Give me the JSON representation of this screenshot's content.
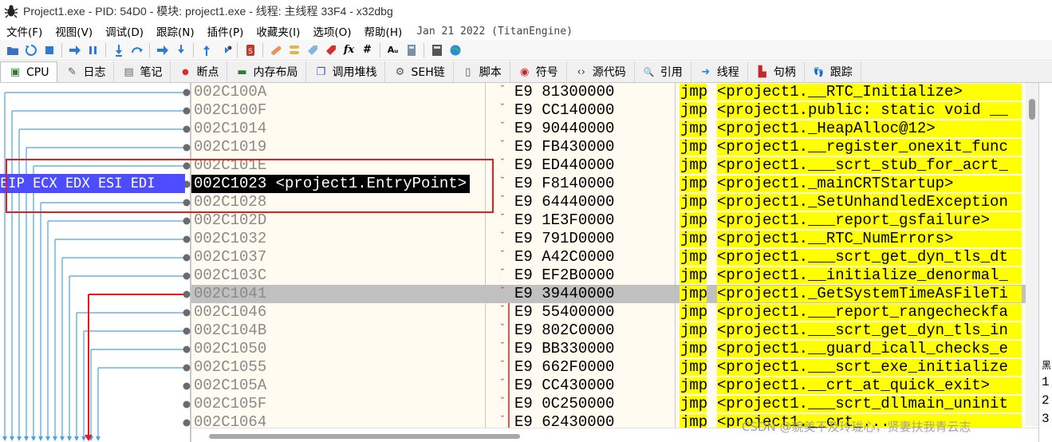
{
  "window": {
    "title": "Project1.exe - PID: 54D0 - 模块: project1.exe - 线程: 主线程 33F4 - x32dbg"
  },
  "menu": {
    "items": [
      "文件(F)",
      "视图(V)",
      "调试(D)",
      "跟踪(N)",
      "插件(P)",
      "收藏夹(I)",
      "选项(O)",
      "帮助(H)"
    ],
    "date": "Jan 21 2022 (TitanEngine)"
  },
  "toolbar": {
    "icons": [
      "open-icon",
      "restart-icon",
      "stop-icon",
      "run-icon",
      "pause-icon",
      "step-into-icon",
      "step-over-icon",
      "trace-into-icon",
      "trace-over-icon",
      "execute-till-return-icon",
      "run-to-user-code-icon",
      "scylla-icon",
      "patches-icon",
      "comments-icon",
      "labels-icon",
      "bookmarks-icon",
      "functions-icon",
      "variables-icon",
      "hash-icon",
      "font-icon",
      "trace-icon",
      "calculator-icon",
      "globe-icon"
    ],
    "fx_label": "fx",
    "hash_label": "#",
    "az_label": "Aᵤ"
  },
  "tabs": [
    {
      "label": "CPU",
      "icon": "cpu-icon",
      "glyph": "▣",
      "active": true
    },
    {
      "label": "日志",
      "icon": "log-icon",
      "glyph": "✎"
    },
    {
      "label": "笔记",
      "icon": "notes-icon",
      "glyph": "▤"
    },
    {
      "label": "断点",
      "icon": "breakpoint-icon",
      "glyph": "●"
    },
    {
      "label": "内存布局",
      "icon": "memory-map-icon",
      "glyph": "▬"
    },
    {
      "label": "调用堆栈",
      "icon": "call-stack-icon",
      "glyph": "❐"
    },
    {
      "label": "SEH链",
      "icon": "seh-icon",
      "glyph": "⚙"
    },
    {
      "label": "脚本",
      "icon": "script-icon",
      "glyph": "▯"
    },
    {
      "label": "符号",
      "icon": "symbols-icon",
      "glyph": "◉"
    },
    {
      "label": "源代码",
      "icon": "source-icon",
      "glyph": "‹›"
    },
    {
      "label": "引用",
      "icon": "references-icon",
      "glyph": "🔍"
    },
    {
      "label": "线程",
      "icon": "threads-icon",
      "glyph": "➜"
    },
    {
      "label": "句柄",
      "icon": "handles-icon",
      "glyph": "▙"
    },
    {
      "label": "跟踪",
      "icon": "trace-icon",
      "glyph": "👣"
    }
  ],
  "registers_label": "EIP ECX EDX ESI EDI",
  "disasm": {
    "rows": [
      {
        "addr": "002C100A",
        "bytes": "E9 81300000",
        "mnemonic": "jmp",
        "operand": "<project1.__RTC_Initialize>"
      },
      {
        "addr": "002C100F",
        "bytes": "E9 CC140000",
        "mnemonic": "jmp",
        "operand": "<project1.public: static void __"
      },
      {
        "addr": "002C1014",
        "bytes": "E9 90440000",
        "mnemonic": "jmp",
        "operand": "<project1._HeapAlloc@12>"
      },
      {
        "addr": "002C1019",
        "bytes": "E9 FB430000",
        "mnemonic": "jmp",
        "operand": "<project1.__register_onexit_func"
      },
      {
        "addr": "002C101E",
        "bytes": "E9 ED440000",
        "mnemonic": "jmp",
        "operand": "<project1.___scrt_stub_for_acrt_"
      },
      {
        "addr": "002C1023",
        "bytes": "E9 F8140000",
        "mnemonic": "jmp",
        "operand": "<project1._mainCRTStartup>",
        "eip": true,
        "eip_label": "<project1.EntryPoint>"
      },
      {
        "addr": "002C1028",
        "bytes": "E9 64440000",
        "mnemonic": "jmp",
        "operand": "<project1._SetUnhandledException"
      },
      {
        "addr": "002C102D",
        "bytes": "E9 1E3F0000",
        "mnemonic": "jmp",
        "operand": "<project1.___report_gsfailure>"
      },
      {
        "addr": "002C1032",
        "bytes": "E9 791D0000",
        "mnemonic": "jmp",
        "operand": "<project1.__RTC_NumErrors>"
      },
      {
        "addr": "002C1037",
        "bytes": "E9 A42C0000",
        "mnemonic": "jmp",
        "operand": "<project1.___scrt_get_dyn_tls_dt"
      },
      {
        "addr": "002C103C",
        "bytes": "E9 EF2B0000",
        "mnemonic": "jmp",
        "operand": "<project1.__initialize_denormal_"
      },
      {
        "addr": "002C1041",
        "bytes": "E9 39440000",
        "mnemonic": "jmp",
        "operand": "<project1._GetSystemTimeAsFileTi",
        "selected": true
      },
      {
        "addr": "002C1046",
        "bytes": "E9 55400000",
        "mnemonic": "jmp",
        "operand": "<project1.___report_rangecheckfa"
      },
      {
        "addr": "002C104B",
        "bytes": "E9 802C0000",
        "mnemonic": "jmp",
        "operand": "<project1.___scrt_get_dyn_tls_in"
      },
      {
        "addr": "002C1050",
        "bytes": "E9 BB330000",
        "mnemonic": "jmp",
        "operand": "<project1.__guard_icall_checks_e"
      },
      {
        "addr": "002C1055",
        "bytes": "E9 662F0000",
        "mnemonic": "jmp",
        "operand": "<project1.___scrt_exe_initialize"
      },
      {
        "addr": "002C105A",
        "bytes": "E9 CC430000",
        "mnemonic": "jmp",
        "operand": "<project1.__crt_at_quick_exit>"
      },
      {
        "addr": "002C105F",
        "bytes": "E9 0C250000",
        "mnemonic": "jmp",
        "operand": "<project1.___scrt_dllmain_uninit"
      },
      {
        "addr": "002C1064",
        "bytes": "E9 62430000",
        "mnemonic": "jmp",
        "operand": "<project1.__crt_..."
      }
    ]
  },
  "right_pane": [
    "黑",
    "1",
    "2",
    "3"
  ],
  "watermark": "CSDN @貌美不及玲珑心，贤妻扶我青云志",
  "colors": {
    "eip_highlight": "#4d4dff",
    "operand_highlight": "#ffff00",
    "annotation_box": "#e02020",
    "jump_arrow": "#e02020",
    "branch_lines": "#4aa3e0"
  }
}
